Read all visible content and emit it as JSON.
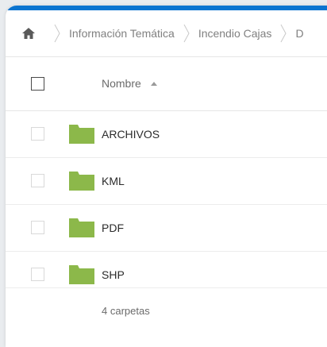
{
  "colors": {
    "accent": "#0a74d0",
    "folder": "#8cb84a"
  },
  "breadcrumb": {
    "home_icon": "home-icon",
    "items": [
      {
        "label": "Información Temática"
      },
      {
        "label": "Incendio Cajas"
      },
      {
        "label": "D"
      }
    ]
  },
  "table": {
    "header": {
      "name_label": "Nombre",
      "sort_icon": "sort-ascending-icon"
    },
    "rows": [
      {
        "name": "ARCHIVOS",
        "icon": "folder-icon"
      },
      {
        "name": "KML",
        "icon": "folder-icon"
      },
      {
        "name": "PDF",
        "icon": "folder-icon"
      },
      {
        "name": "SHP",
        "icon": "folder-icon"
      }
    ],
    "footer": "4 carpetas"
  }
}
